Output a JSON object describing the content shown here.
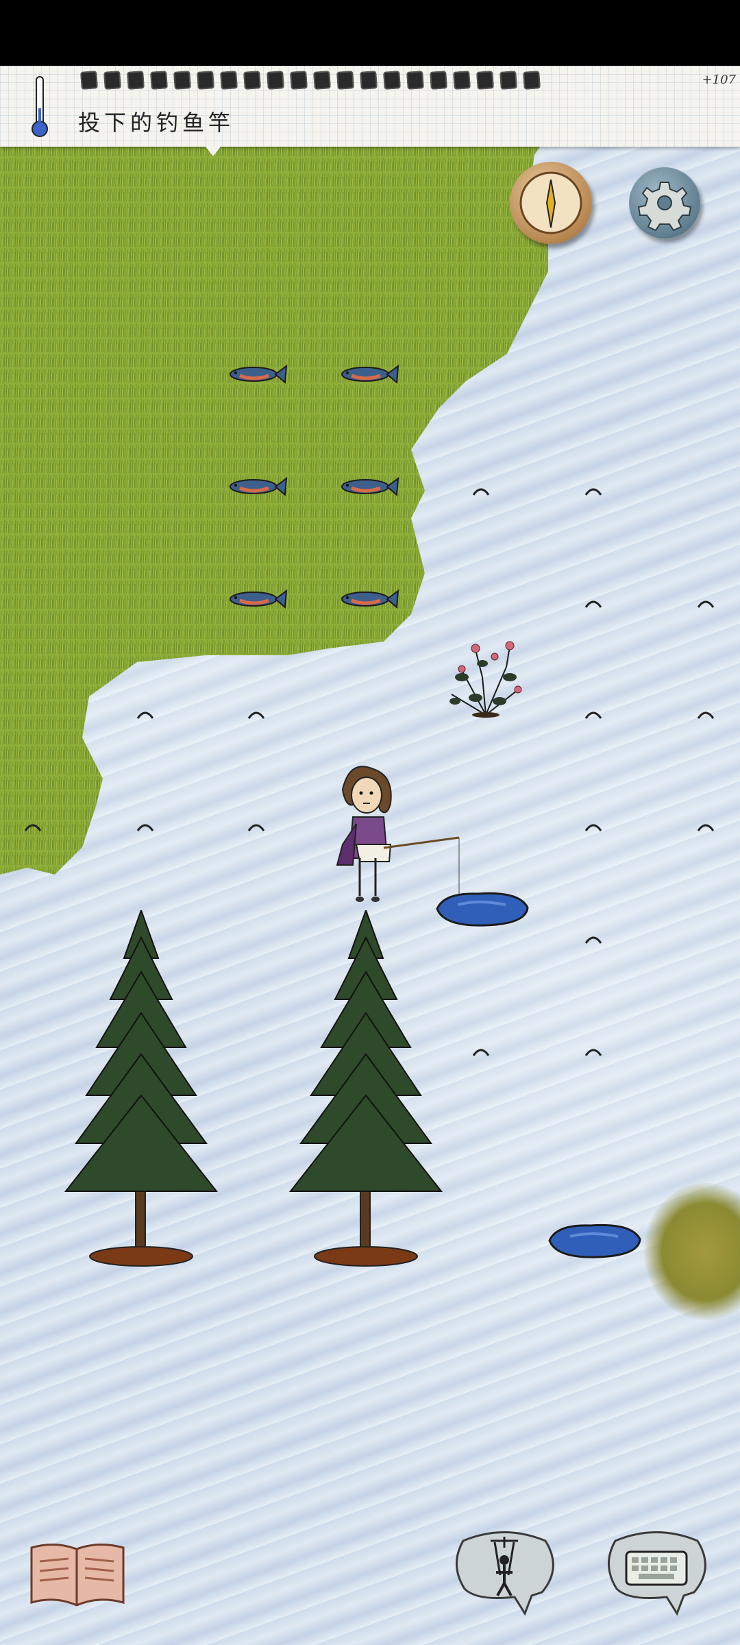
{
  "header": {
    "action_label": "投下的钓鱼竿",
    "day_counter": "+107",
    "forecast_days": 20,
    "thermometer_icon": "thermometer-icon"
  },
  "buttons": {
    "compass": "compass-icon",
    "settings": "gear-icon",
    "journal": "journal-book-icon",
    "puppet": "marionette-icon",
    "keyboard": "keyboard-icon"
  },
  "colors": {
    "grass": "#8fae3a",
    "snow": "#d4e0ee",
    "water": "#2f5fb8",
    "compass_needle": "#e0b02a"
  }
}
